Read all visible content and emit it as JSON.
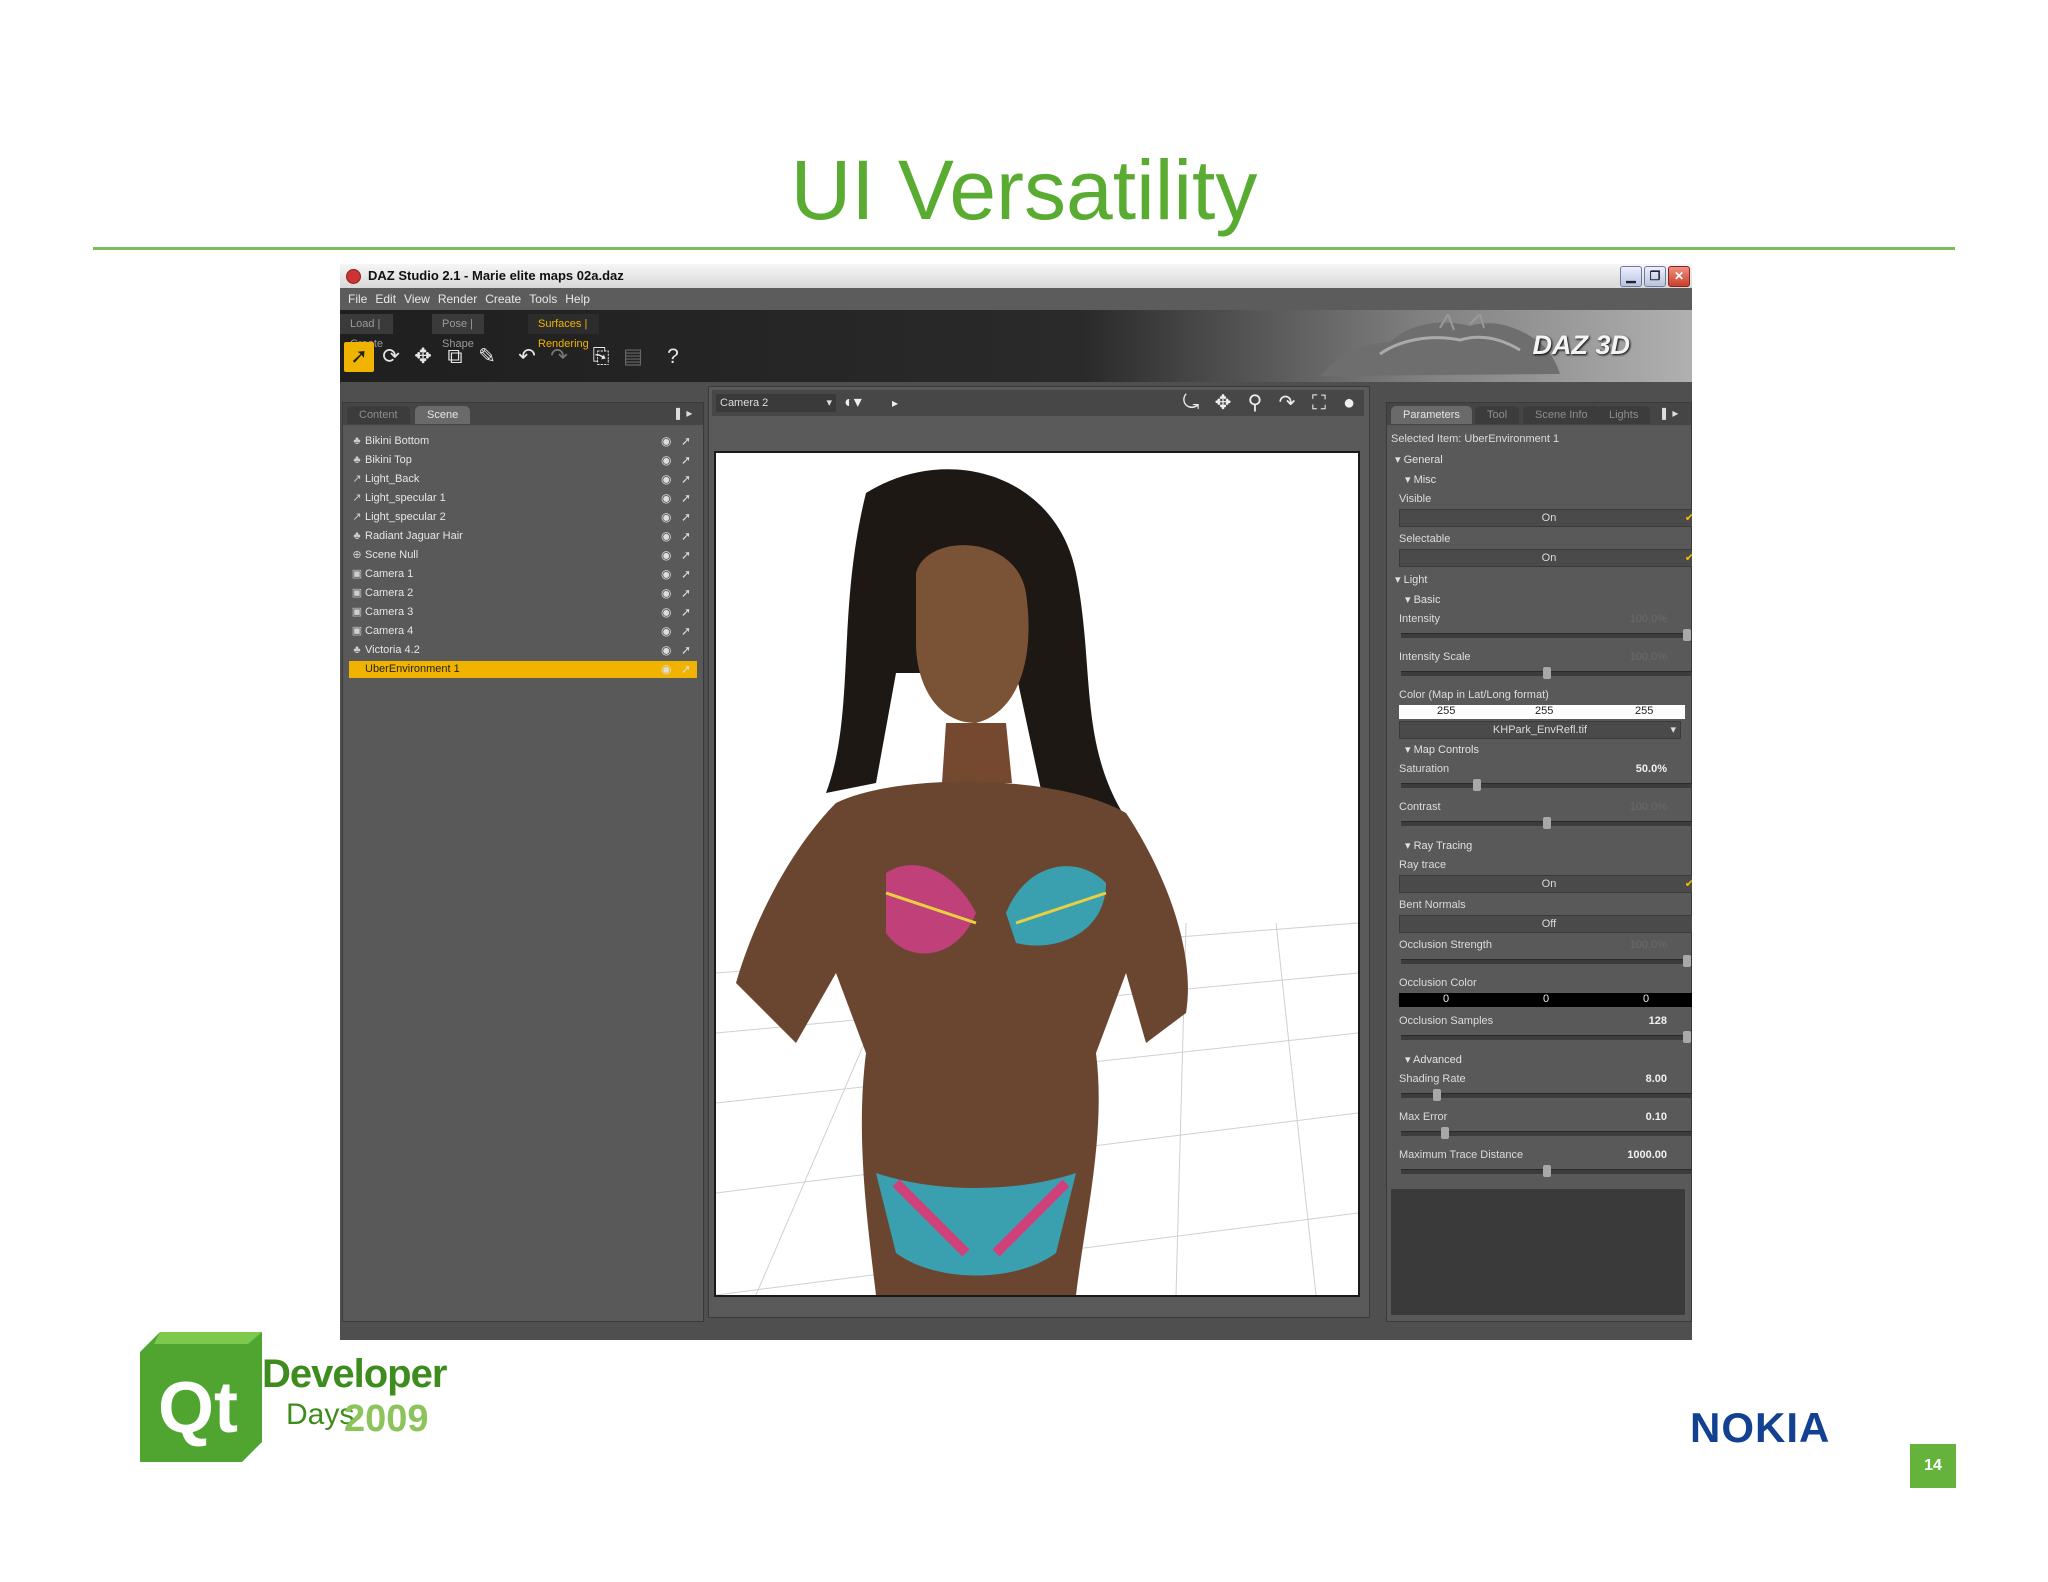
{
  "slide": {
    "title": "UI Versatility",
    "page_number": "14",
    "footer_developer": "Developer",
    "footer_days": "Days",
    "footer_year": "2009",
    "footer_nokia": "NOKIA",
    "footer_qt": "Qt"
  },
  "window": {
    "title": "DAZ Studio 2.1  - Marie elite maps 02a.daz",
    "min": "▁",
    "max": "❐",
    "close": "✕"
  },
  "menu": [
    "File",
    "Edit",
    "View",
    "Render",
    "Create",
    "Tools",
    "Help"
  ],
  "room_tabs": [
    "Load | Create",
    "Pose | Shape",
    "Surfaces | Rendering"
  ],
  "brand": "DAZ 3D",
  "scene_panel": {
    "tabs": [
      "Content",
      "Scene"
    ],
    "items": [
      {
        "label": "Bikini Bottom",
        "icon": "figure"
      },
      {
        "label": "Bikini Top",
        "icon": "figure"
      },
      {
        "label": "Light_Back",
        "icon": "light"
      },
      {
        "label": "Light_specular 1",
        "icon": "light"
      },
      {
        "label": "Light_specular 2",
        "icon": "light"
      },
      {
        "label": "Radiant Jaguar Hair",
        "icon": "figure"
      },
      {
        "label": "Scene Null",
        "icon": "null"
      },
      {
        "label": "Camera 1",
        "icon": "camera"
      },
      {
        "label": "Camera 2",
        "icon": "camera"
      },
      {
        "label": "Camera 3",
        "icon": "camera"
      },
      {
        "label": "Camera 4",
        "icon": "camera"
      },
      {
        "label": "Victoria 4.2",
        "icon": "figure"
      },
      {
        "label": "UberEnvironment 1",
        "icon": "none",
        "selected": true
      }
    ]
  },
  "viewport": {
    "camera": "Camera 2"
  },
  "params": {
    "tabs": [
      "Parameters",
      "Tool",
      "Scene Info",
      "Lights"
    ],
    "selected_item": "Selected Item: UberEnvironment 1",
    "general": "General",
    "misc": "Misc",
    "visible_label": "Visible",
    "visible_value": "On",
    "selectable_label": "Selectable",
    "selectable_value": "On",
    "light": "Light",
    "basic": "Basic",
    "intensity_label": "Intensity",
    "intensity_value": "100.0%",
    "intensity_scale_label": "Intensity Scale",
    "intensity_scale_value": "100.0%",
    "color_label": "Color (Map in Lat/Long format)",
    "color_values": [
      "255",
      "255",
      "255"
    ],
    "map_file": "KHPark_EnvRefl.tif",
    "map_controls": "Map Controls",
    "saturation_label": "Saturation",
    "saturation_value": "50.0%",
    "contrast_label": "Contrast",
    "contrast_value": "100.0%",
    "ray_tracing": "Ray Tracing",
    "ray_trace_label": "Ray trace",
    "ray_trace_value": "On",
    "bent_normals_label": "Bent Normals",
    "bent_normals_value": "Off",
    "occlusion_strength_label": "Occlusion Strength",
    "occlusion_strength_value": "100.0%",
    "occlusion_color_label": "Occlusion Color",
    "occlusion_color_values": [
      "0",
      "0",
      "0"
    ],
    "occlusion_samples_label": "Occlusion Samples",
    "occlusion_samples_value": "128",
    "advanced": "Advanced",
    "shading_rate_label": "Shading Rate",
    "shading_rate_value": "8.00",
    "max_error_label": "Max Error",
    "max_error_value": "0.10",
    "max_trace_label": "Maximum Trace Distance",
    "max_trace_value": "1000.00"
  },
  "colors": {
    "title_green": "#5aab32",
    "accent_orange": "#f0b400",
    "nokia_blue": "#124191"
  }
}
